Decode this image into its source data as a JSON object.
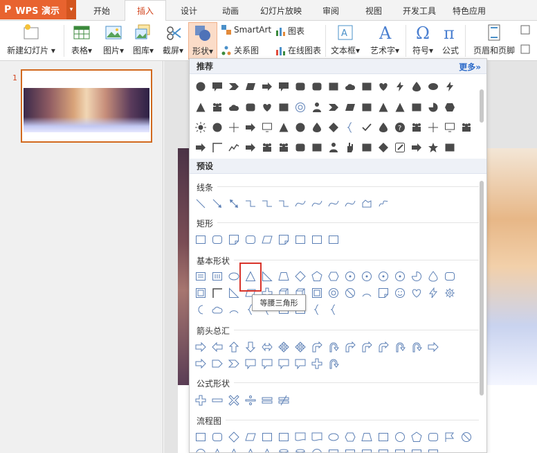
{
  "app": {
    "name": "WPS 演示",
    "logo": "P",
    "menu_arrow": "▾"
  },
  "tabs": [
    "开始",
    "插入",
    "设计",
    "动画",
    "幻灯片放映",
    "审阅",
    "视图",
    "开发工具",
    "特色应用"
  ],
  "active_tab": "插入",
  "ribbon": {
    "new_slide": "新建幻灯片",
    "table": "表格",
    "picture": "图片",
    "gallery": "图库",
    "screenshot": "截屏",
    "shape": "形状",
    "smartart": "SmartArt",
    "chart": "图表",
    "relation": "关系图",
    "online_chart": "在线图表",
    "textbox": "文本框",
    "wordart": "艺术字",
    "symbol": "符号",
    "formula": "公式",
    "header_footer": "页眉和页脚",
    "dropdown_arrow": "▾"
  },
  "slides": {
    "count_label": "1"
  },
  "shape_panel": {
    "recommended_title": "推荐",
    "more_link": "更多»",
    "presets_title": "预设",
    "sections": [
      {
        "label": "线条"
      },
      {
        "label": "矩形"
      },
      {
        "label": "基本形状"
      },
      {
        "label": "箭头总汇"
      },
      {
        "label": "公式形状"
      },
      {
        "label": "流程图"
      }
    ],
    "tooltip": "等腰三角形"
  },
  "colors": {
    "accent": "#d2451e",
    "app_orange": "#e8632f",
    "shape_stroke": "#5b7fb5",
    "rec_fill": "#4a4a4a",
    "highlight": "#d8332a"
  }
}
